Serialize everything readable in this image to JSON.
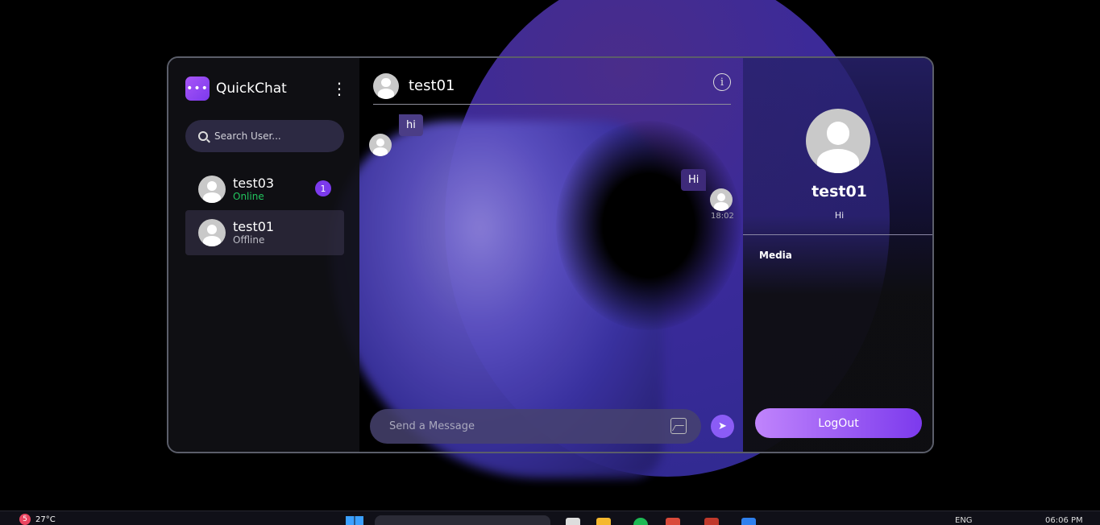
{
  "app": {
    "brand": "QuickChat",
    "search": {
      "placeholder": "Search User..."
    },
    "users": [
      {
        "name": "test03",
        "status": "Online",
        "unread": "1"
      },
      {
        "name": "test01",
        "status": "Offline"
      }
    ]
  },
  "chat": {
    "title": "test01",
    "messages": [
      {
        "text": "hi",
        "direction": "incoming"
      },
      {
        "text": "Hi",
        "direction": "outgoing",
        "time": "18:02"
      }
    ],
    "composer": {
      "placeholder": "Send a Message"
    }
  },
  "profile": {
    "name": "test01",
    "bio": "Hi",
    "media_label": "Media",
    "logout_label": "LogOut"
  },
  "taskbar": {
    "weather_badge": "5",
    "temperature": "27°C",
    "language": "ENG",
    "time": "06:06 PM"
  },
  "colors": {
    "accent": "#8b5cf6",
    "online": "#22c55e",
    "bubble": "#4b3d86"
  }
}
